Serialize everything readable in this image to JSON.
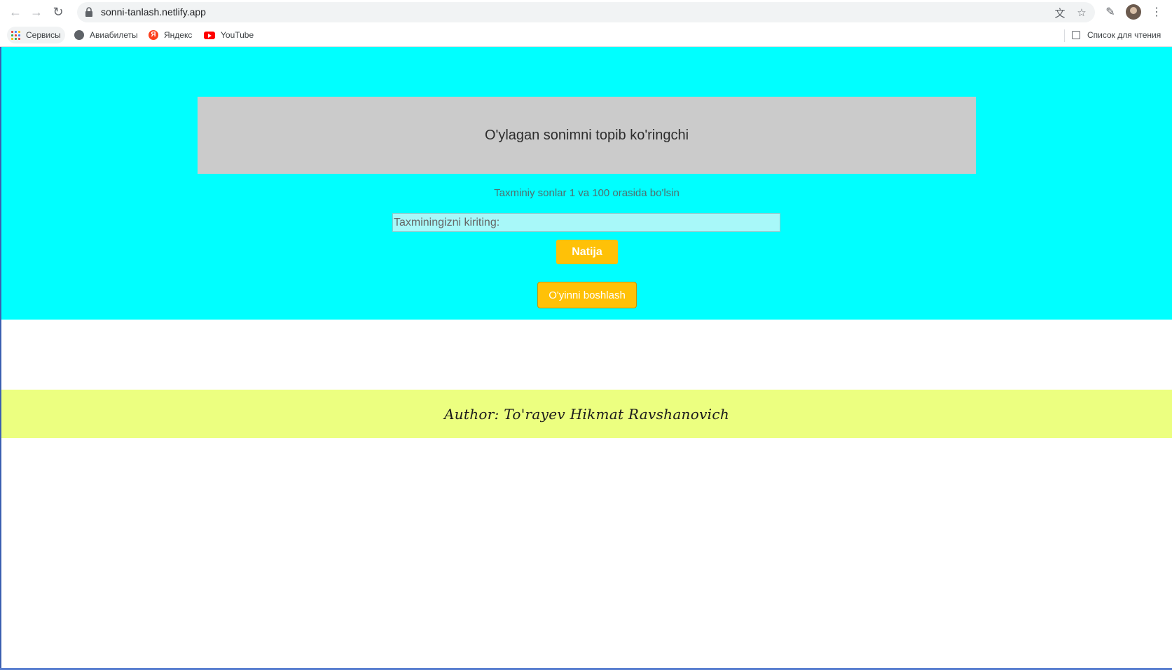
{
  "browser": {
    "url": "sonni-tanlash.netlify.app",
    "bookmarks": [
      {
        "label": "Сервисы",
        "icon": "apps-icon"
      },
      {
        "label": "Авиабилеты",
        "icon": "globe-icon"
      },
      {
        "label": "Яндекс",
        "icon": "yandex-icon"
      },
      {
        "label": "YouTube",
        "icon": "youtube-icon"
      }
    ],
    "reading_list": "Список для чтения"
  },
  "page": {
    "title": "O'ylagan sonimni topib ko'ringchi",
    "hint": "Taxminiy sonlar 1 va 100 orasida bo'lsin",
    "input_placeholder": "Taxminingizni kiriting:",
    "input_value": "",
    "result_button": "Natija",
    "start_button": "O'yinni boshlash",
    "footer": "Author: To'rayev Hikmat Ravshanovich",
    "colors": {
      "hero_bg": "#00ffff",
      "title_bg": "#cbcbcb",
      "button": "#ffc107",
      "footer_bg": "#ecff80"
    }
  }
}
